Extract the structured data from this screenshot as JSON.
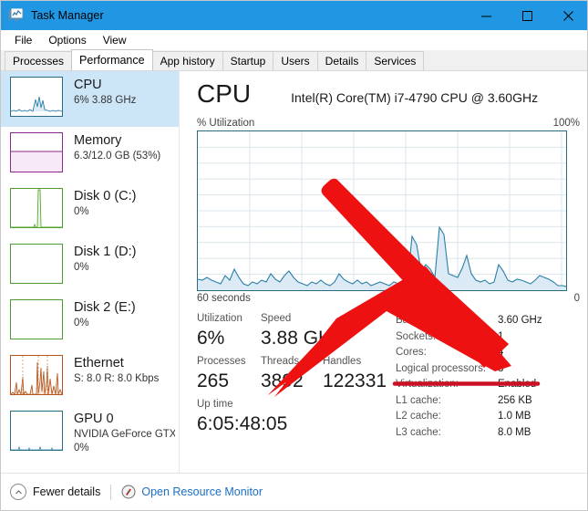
{
  "window": {
    "title": "Task Manager",
    "icon": "task-manager-icon",
    "minimize": "─",
    "maximize": "☐",
    "close": "✕"
  },
  "menu": {
    "items": [
      {
        "label": "File"
      },
      {
        "label": "Options"
      },
      {
        "label": "View"
      }
    ]
  },
  "tabs": [
    {
      "label": "Processes",
      "active": false
    },
    {
      "label": "Performance",
      "active": true
    },
    {
      "label": "App history",
      "active": false
    },
    {
      "label": "Startup",
      "active": false
    },
    {
      "label": "Users",
      "active": false
    },
    {
      "label": "Details",
      "active": false
    },
    {
      "label": "Services",
      "active": false
    }
  ],
  "sidebar": {
    "items": [
      {
        "name": "cpu",
        "title": "CPU",
        "sub": "6%  3.88 GHz",
        "sub2": "",
        "selected": true,
        "color": "#1c6b8c"
      },
      {
        "name": "memory",
        "title": "Memory",
        "sub": "6.3/12.0 GB (53%)",
        "sub2": "",
        "selected": false,
        "color": "#8b2a8b"
      },
      {
        "name": "disk-0",
        "title": "Disk 0 (C:)",
        "sub": "0%",
        "sub2": "",
        "selected": false,
        "color": "#4e9a2f"
      },
      {
        "name": "disk-1",
        "title": "Disk 1 (D:)",
        "sub": "0%",
        "sub2": "",
        "selected": false,
        "color": "#4e9a2f"
      },
      {
        "name": "disk-2",
        "title": "Disk 2 (E:)",
        "sub": "0%",
        "sub2": "",
        "selected": false,
        "color": "#4e9a2f"
      },
      {
        "name": "ethernet",
        "title": "Ethernet",
        "sub": "S: 8.0 R: 8.0 Kbps",
        "sub2": "",
        "selected": false,
        "color": "#b5551d"
      },
      {
        "name": "gpu-0",
        "title": "GPU 0",
        "sub": "NVIDIA GeForce GTX",
        "sub2": "0%",
        "selected": false,
        "color": "#1c6b8c"
      }
    ]
  },
  "main": {
    "title": "CPU",
    "model": "Intel(R) Core(TM) i7-4790 CPU @ 3.60GHz",
    "graph": {
      "y_axis_label": "% Utilization",
      "y_max_label": "100%",
      "x_left_label": "60 seconds",
      "x_right_label": "0",
      "line_color": "#2a7fa5",
      "fill_color": "#dbeaf4"
    },
    "stats": {
      "utilization_label": "Utilization",
      "utilization_value": "6%",
      "speed_label": "Speed",
      "speed_value": "3.88 GHz",
      "processes_label": "Processes",
      "processes_value": "265",
      "threads_label": "Threads",
      "threads_value": "3892",
      "handles_label": "Handles",
      "handles_value": "122331",
      "uptime_label": "Up time",
      "uptime_value": "6:05:48:05"
    },
    "details": [
      {
        "key": "Base speed:",
        "value": "3.60 GHz"
      },
      {
        "key": "Sockets:",
        "value": "1"
      },
      {
        "key": "Cores:",
        "value": "4"
      },
      {
        "key": "Logical processors:",
        "value": "8"
      },
      {
        "key": "Virtualization:",
        "value": "Enabled"
      },
      {
        "key": "L1 cache:",
        "value": "256 KB"
      },
      {
        "key": "L2 cache:",
        "value": "1.0 MB"
      },
      {
        "key": "L3 cache:",
        "value": "8.0 MB"
      }
    ]
  },
  "statusbar": {
    "fewer_details": "Fewer details",
    "fewer_details_icon": "chevron-up-circle-icon",
    "resource_monitor": "Open Resource Monitor",
    "resource_monitor_icon": "resource-monitor-icon"
  },
  "annotation": {
    "arrow_color": "#ee1111",
    "underline_color": "#cc1122",
    "target": "Logical processors"
  },
  "chart_data": {
    "type": "area",
    "title": "CPU % Utilization",
    "xlabel": "60 seconds",
    "ylabel": "% Utilization",
    "ylim": [
      0,
      100
    ],
    "xlim": [
      60,
      0
    ],
    "grid": true,
    "series": [
      {
        "name": "CPU utilization",
        "values": [
          7,
          6,
          8,
          6,
          5,
          4,
          9,
          6,
          13,
          8,
          4,
          3,
          5,
          4,
          6,
          5,
          10,
          7,
          5,
          9,
          12,
          8,
          5,
          4,
          3,
          5,
          4,
          6,
          4,
          3,
          5,
          10,
          7,
          5,
          4,
          6,
          4,
          5,
          3,
          4,
          5,
          4,
          3,
          5,
          4,
          6,
          5,
          34,
          29,
          12,
          16,
          13,
          8,
          40,
          35,
          10,
          9,
          8,
          14,
          22,
          10,
          6,
          5,
          6,
          4,
          5,
          16,
          11,
          6,
          5,
          7,
          6,
          5,
          4,
          6,
          9,
          8,
          7,
          5,
          3
        ]
      }
    ]
  }
}
